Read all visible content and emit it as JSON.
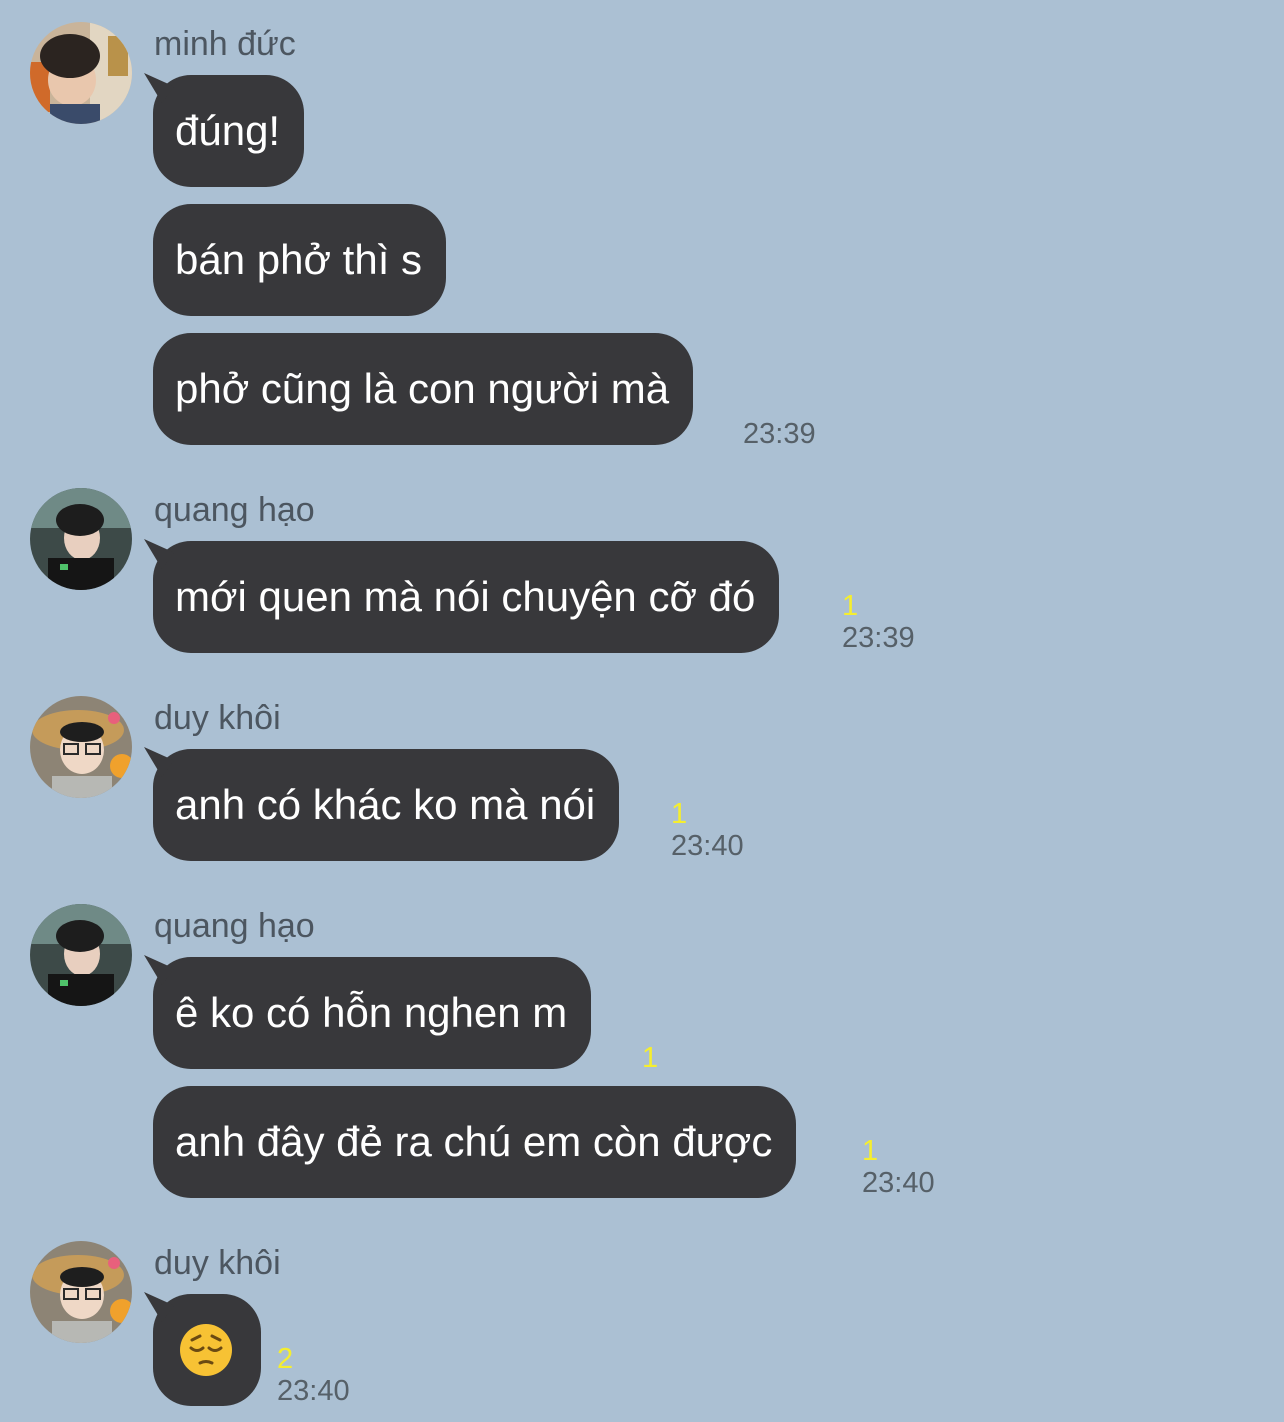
{
  "messages": [
    {
      "sender": "minh đức",
      "avatar": "avatar-minh-duc",
      "bubbles": [
        {
          "text": "đúng!"
        },
        {
          "text": "bán phở thì s"
        },
        {
          "text": "phở cũng là con người mà",
          "time": "23:39"
        }
      ]
    },
    {
      "sender": "quang hạo",
      "avatar": "avatar-quang-hao",
      "bubbles": [
        {
          "text": "mới quen mà nói chuyện cỡ đó",
          "unread": "1",
          "time": "23:39"
        }
      ]
    },
    {
      "sender": "duy khôi",
      "avatar": "avatar-duy-khoi",
      "bubbles": [
        {
          "text": "anh có khác ko mà nói",
          "unread": "1",
          "time": "23:40"
        }
      ]
    },
    {
      "sender": "quang hạo",
      "avatar": "avatar-quang-hao",
      "bubbles": [
        {
          "text": "ê ko có hỗn nghen m",
          "unread": "1"
        },
        {
          "text": "anh đây đẻ ra chú em còn được",
          "unread": "1",
          "time": "23:40"
        }
      ]
    },
    {
      "sender": "duy khôi",
      "avatar": "avatar-duy-khoi",
      "bubbles": [
        {
          "emoji": "pensive-face-emoji",
          "unread": "2",
          "time": "23:40"
        }
      ]
    }
  ],
  "colors": {
    "background": "#abc0d3",
    "bubble": "#38383b",
    "bubble_text": "#ffffff",
    "unread": "#f5ee2f",
    "timestamp": "#566068",
    "sender_name": "#4c5660"
  }
}
